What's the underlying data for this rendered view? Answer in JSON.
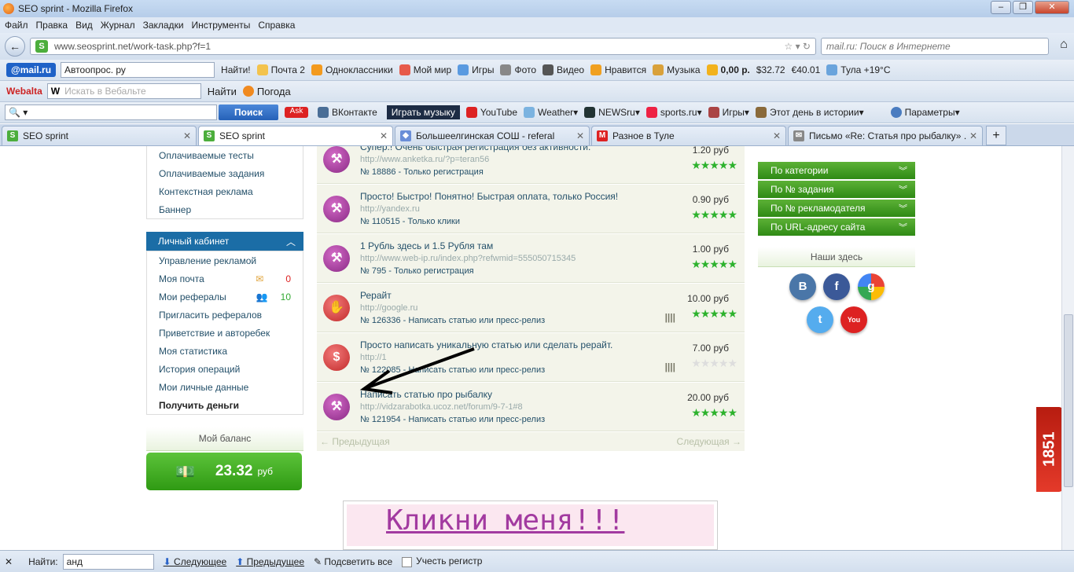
{
  "window": {
    "title": "SEO sprint - Mozilla Firefox"
  },
  "menubar": [
    "Файл",
    "Правка",
    "Вид",
    "Журнал",
    "Закладки",
    "Инструменты",
    "Справка"
  ],
  "address": {
    "url": "www.seosprint.net/work-task.php?f=1",
    "search_placeholder": "mail.ru: Поиск в Интернете"
  },
  "toolbar1": {
    "mailru": "@mail.ru",
    "search_value": "Автоопрос. ру",
    "find_btn": "Найти!",
    "items": [
      "Почта 2",
      "Одноклассники",
      "Мой мир",
      "Игры",
      "Фото",
      "Видео",
      "Нравится",
      "Музыка",
      "0,00 р.",
      "$32.72",
      "€40.01",
      "Тула +19°C"
    ]
  },
  "toolbar2": {
    "webalta": "Webalta",
    "placeholder": "Искать в Вебальте",
    "find": "Найти",
    "weather": "Погода"
  },
  "toolbar3": {
    "search_btn": "Поиск",
    "items": [
      "ВКонтакте",
      "Играть музыку",
      "YouTube",
      "Weather",
      "NEWSru",
      "sports.ru",
      "Игры",
      "Этот день в истории",
      "Параметры"
    ]
  },
  "tabs": [
    {
      "label": "SEO sprint",
      "active": false
    },
    {
      "label": "SEO sprint",
      "active": true
    },
    {
      "label": "Большеелгинская СОШ - referal",
      "active": false
    },
    {
      "label": "Разное в Туле",
      "active": false
    },
    {
      "label": "Письмо «Re: Статья про рыбалку» ...",
      "active": false
    }
  ],
  "sidebar": {
    "top_links": [
      "Оплачиваемые тесты",
      "Оплачиваемые задания",
      "Контекстная реклама",
      "Баннер"
    ],
    "cabinet_title": "Личный кабинет",
    "cabinet_links": [
      {
        "label": "Управление рекламой",
        "count": ""
      },
      {
        "label": "Моя почта",
        "count": "0"
      },
      {
        "label": "Мои рефералы",
        "count": "10"
      },
      {
        "label": "Пригласить рефералов",
        "count": ""
      },
      {
        "label": "Приветствие и авторебек",
        "count": ""
      },
      {
        "label": "Моя статистика",
        "count": ""
      },
      {
        "label": "История операций",
        "count": ""
      },
      {
        "label": "Мои личные данные",
        "count": ""
      },
      {
        "label": "Получить деньги",
        "count": ""
      }
    ],
    "balance_label": "Мой баланс",
    "balance_value": "23.32",
    "balance_unit": "руб"
  },
  "tasks": [
    {
      "title": "Супер.! Очень быстрая регистрация без активности.",
      "url": "http://www.anketka.ru/?p=teran56",
      "meta": "№ 18886 - Только регистрация",
      "price": "1.20 руб",
      "rating": 5,
      "icon": "purple"
    },
    {
      "title": "Просто! Быстро! Понятно! Быстрая оплата, только Россия!",
      "url": "http://yandex.ru",
      "meta": "№ 110515 - Только клики",
      "price": "0.90 руб",
      "rating": 5,
      "icon": "purple"
    },
    {
      "title": "1 Рубль здесь и 1.5 Рубля там",
      "url": "http://www.web-ip.ru/index.php?refwmid=555050715345",
      "meta": "№ 795 - Только регистрация",
      "price": "1.00 руб",
      "rating": 5,
      "icon": "purple"
    },
    {
      "title": "Рерайт",
      "url": "http://google.ru",
      "meta": "№ 126336 - Написать статью или пресс-релиз",
      "price": "10.00 руб",
      "rating": 5,
      "icon": "red-hand",
      "tally": "𝍸"
    },
    {
      "title": "Просто написать уникальную статью или сделать рерайт.",
      "url": "http://1",
      "meta": "№ 122085 - Написать статью или пресс-релиз",
      "price": "7.00 руб",
      "rating": 0,
      "icon": "red-dollar",
      "tally": "𝍸"
    },
    {
      "title": "Написать статью про рыбалку",
      "url": "http://vidzarabotka.ucoz.net/forum/9-7-1#8",
      "meta": "№ 121954 - Написать статью или пресс-релиз",
      "price": "20.00 руб",
      "rating": 5,
      "icon": "purple"
    }
  ],
  "pager": {
    "prev": "← Предыдущая",
    "next": "Следующая →"
  },
  "banner": {
    "text": "Кликни меня!!!"
  },
  "filters": [
    "По категории",
    "По № задания",
    "По № рекламодателя",
    "По URL-адресу сайта"
  ],
  "here_label": "Наши здесь",
  "badge": "1851",
  "findbar": {
    "label": "Найти:",
    "value": "анд",
    "next": "Следующее",
    "prev": "Предыдущее",
    "highlight": "Подсветить все",
    "match_case": "Учесть регистр"
  }
}
